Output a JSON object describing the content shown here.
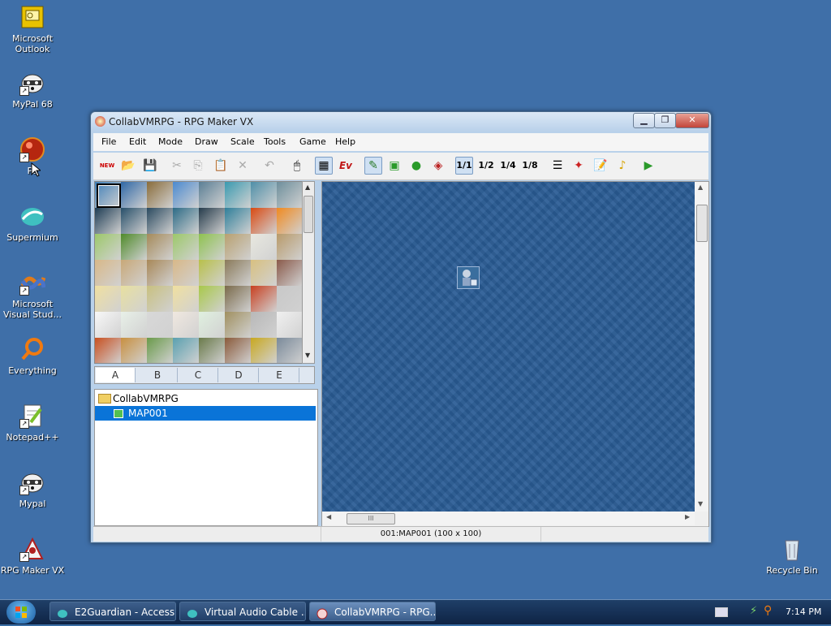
{
  "desktop_icons": [
    {
      "label": "Microsoft\nOutlook",
      "icon": "outlook-icon"
    },
    {
      "label": "MyPal 68",
      "icon": "raccoon-icon"
    },
    {
      "label": "Pe",
      "icon": "red-ball-icon"
    },
    {
      "label": "Supermium",
      "icon": "supermium-icon"
    },
    {
      "label": "Microsoft\nVisual Stud...",
      "icon": "visual-studio-icon"
    },
    {
      "label": "Everything",
      "icon": "everything-icon"
    },
    {
      "label": "Notepad++",
      "icon": "notepadpp-icon"
    },
    {
      "label": "Mypal",
      "icon": "raccoon-icon"
    },
    {
      "label": "RPG Maker VX",
      "icon": "rpgmaker-icon"
    },
    {
      "label": "Recycle Bin",
      "icon": "recycle-bin-icon"
    }
  ],
  "window": {
    "title": "CollabVMRPG - RPG Maker VX",
    "menus": [
      "File",
      "Edit",
      "Mode",
      "Draw",
      "Scale",
      "Tools",
      "Game",
      "Help"
    ],
    "toolbar": {
      "new_label": "NEW",
      "events_label": "Ev",
      "scale_labels": [
        "1/1",
        "1/2",
        "1/4",
        "1/8"
      ]
    },
    "tileset_tabs": [
      "A",
      "B",
      "C",
      "D",
      "E"
    ],
    "tree": {
      "project": "CollabVMRPG",
      "map": "MAP001"
    },
    "status": "001:MAP001 (100 x 100)",
    "scroll_grip": "III"
  },
  "taskbar": {
    "tasks": [
      "E2Guardian - Access...",
      "Virtual Audio Cable ...",
      "CollabVMRPG - RPG..."
    ],
    "clock": "7:14 PM"
  },
  "colors": {
    "desktop": "#3f6fa8",
    "water": "#2a5c95",
    "selection": "#0a74d8"
  }
}
